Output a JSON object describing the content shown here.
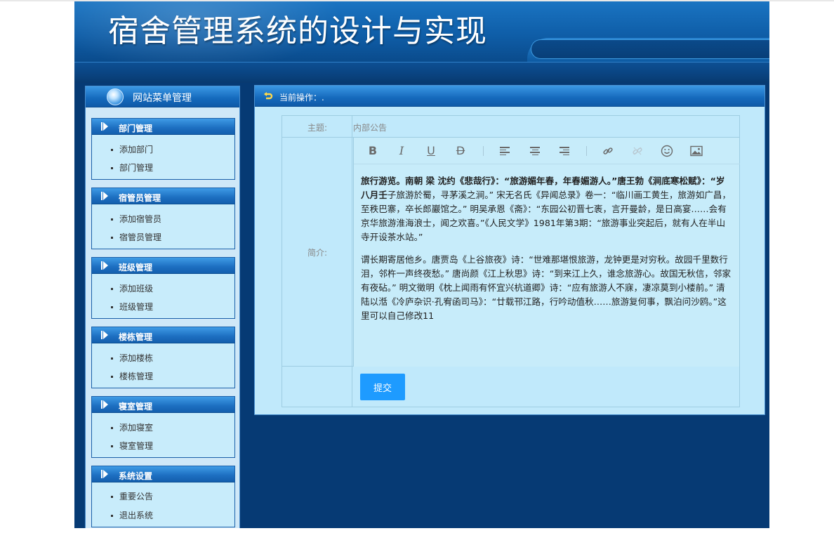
{
  "header": {
    "title": "宿舍管理系统的设计与实现"
  },
  "sidebar": {
    "title": "网站菜单管理",
    "groups": [
      {
        "title": "部门管理",
        "items": [
          "添加部门",
          "部门管理"
        ]
      },
      {
        "title": "宿管员管理",
        "items": [
          "添加宿管员",
          "宿管员管理"
        ]
      },
      {
        "title": "班级管理",
        "items": [
          "添加班级",
          "班级管理"
        ]
      },
      {
        "title": "楼栋管理",
        "items": [
          "添加楼栋",
          "楼栋管理"
        ]
      },
      {
        "title": "寝室管理",
        "items": [
          "添加寝室",
          "寝室管理"
        ]
      },
      {
        "title": "系统设置",
        "items": [
          "重要公告",
          "退出系统"
        ]
      }
    ]
  },
  "panel": {
    "breadcrumb": "当前操作：.",
    "form": {
      "subject_label": "主题:",
      "subject_value": "内部公告",
      "intro_label": "简介:",
      "toolbar": [
        "bold-icon",
        "italic-icon",
        "underline-icon",
        "strikethrough-icon",
        "align-left-icon",
        "align-center-icon",
        "align-right-icon",
        "link-icon",
        "unlink-icon",
        "emoji-icon",
        "image-icon"
      ],
      "content": {
        "p1_bold": "旅行游览。南朝 梁 沈约《悲哉行》：“旅游媚年春，年春媚游人。”唐王勃《涧底寒松赋》：“岁八月壬",
        "p1_rest": "子旅游於蜀，寻茅溪之涧。” 宋无名氏《异闻总录》卷一：“临川画工黄生，旅游如广昌，至秩巴寨，卒长郎巖馆之。” 明吴承恩《斋》：“东园公初晋七袠，言开曼龄，是日高宴……会有京华旅游淮海浪士，闻之欢喜。”《人民文学》1981年第3期：“旅游事业突起后，就有人在半山寺开设茶水站。”",
        "p2": "谓长期寄居他乡。唐贾岛《上谷旅夜》诗：“世难那堪恨旅游，龙钟更是对穷秋。故园千里数行泪，邻杵一声终夜愁。” 唐尚颜《江上秋思》诗：“到来江上久，谁念旅游心。故国无秋信，邻家有夜砧。” 明文徵明《枕上闻雨有怀宜兴杭道卿》诗：“应有旅游人不寐，凄凉莫到小楼前。” 清陆以湉《冷庐杂识·孔宥函司马》：“廿载邗江路，行吟动值秋……旅游复何事，飘泊问沙鸥。”这里可以自己修改11"
      },
      "submit_label": "提交"
    }
  }
}
